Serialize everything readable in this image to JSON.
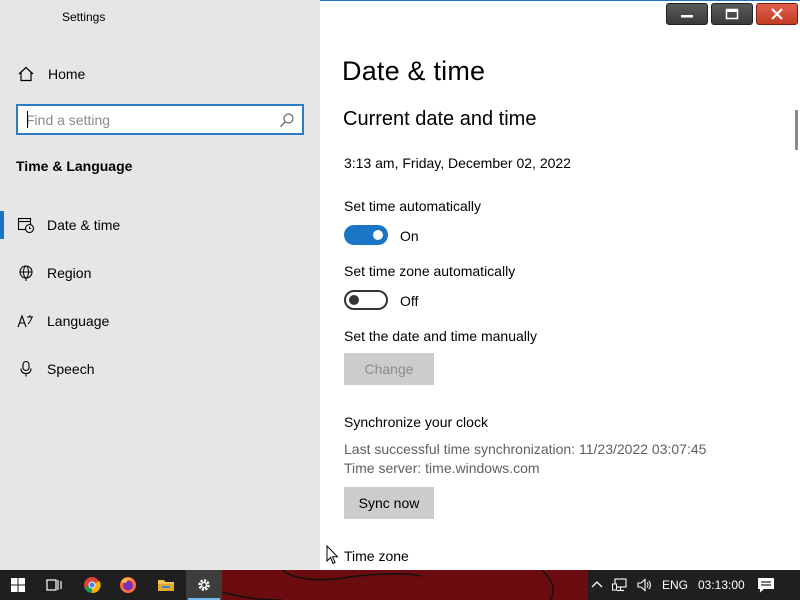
{
  "window": {
    "title": "Settings"
  },
  "sidebar": {
    "home_label": "Home",
    "search_placeholder": "Find a setting",
    "section": "Time & Language",
    "items": [
      {
        "label": "Date & time",
        "icon": "calendar-clock-icon",
        "active": true
      },
      {
        "label": "Region",
        "icon": "globe-icon",
        "active": false
      },
      {
        "label": "Language",
        "icon": "language-icon",
        "active": false
      },
      {
        "label": "Speech",
        "icon": "microphone-icon",
        "active": false
      }
    ]
  },
  "main": {
    "title": "Date & time",
    "subtitle": "Current date and time",
    "current_datetime": "3:13 am, Friday, December 02, 2022",
    "set_time_auto": {
      "label": "Set time automatically",
      "state": "On"
    },
    "set_timezone_auto": {
      "label": "Set time zone automatically",
      "state": "Off"
    },
    "manual": {
      "label": "Set the date and time manually",
      "button": "Change"
    },
    "sync": {
      "heading": "Synchronize your clock",
      "last_sync": "Last successful time synchronization: 11/23/2022 03:07:45",
      "server": "Time server: time.windows.com",
      "button": "Sync now"
    },
    "timezone_label": "Time zone"
  },
  "taskbar": {
    "apps": [
      "start-icon",
      "task-view-icon",
      "chrome-icon",
      "firefox-icon",
      "file-explorer-icon",
      "settings-icon"
    ],
    "tray": {
      "language": "ENG",
      "time": "03:13:00"
    }
  },
  "colors": {
    "accent": "#1a76c4",
    "sidebar_bg": "#e6e6e6",
    "taskbar_bg": "#1f1f1f"
  }
}
